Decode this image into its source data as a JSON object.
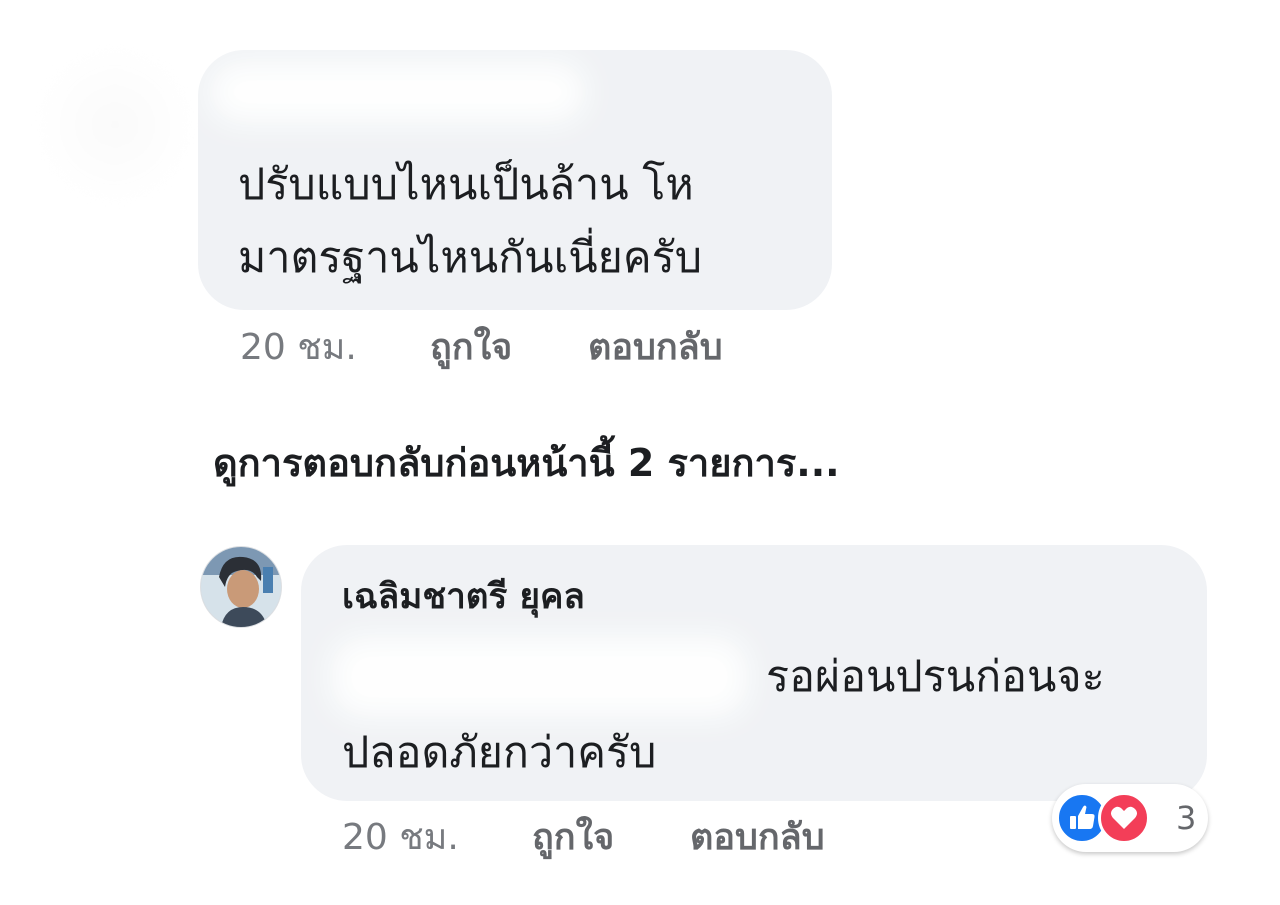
{
  "comment1": {
    "text_line1": "ปรับแบบไหนเป็นล้าน โห",
    "text_line2": "มาตรฐานไหนกันเนี่ยครับ",
    "time": "20 ชม.",
    "like_label": "ถูกใจ",
    "reply_label": "ตอบกลับ"
  },
  "view_previous_replies": "ดูการตอบกลับก่อนหน้านี้ 2 รายการ...",
  "comment2": {
    "author": "เฉลิมชาตรี ยุคล",
    "text_line1": "รอผ่อนปรนก่อนจะ",
    "text_line2": "ปลอดภัยกว่าครับ",
    "time": "20 ชม.",
    "like_label": "ถูกใจ",
    "reply_label": "ตอบกลับ",
    "reactions": {
      "icons": [
        "like-icon",
        "love-icon"
      ],
      "count": "3"
    }
  },
  "colors": {
    "bubble": "#f0f2f5",
    "text": "#1c1e21",
    "meta": "#65676b",
    "like": "#1877f2",
    "love": "#f33e58"
  }
}
